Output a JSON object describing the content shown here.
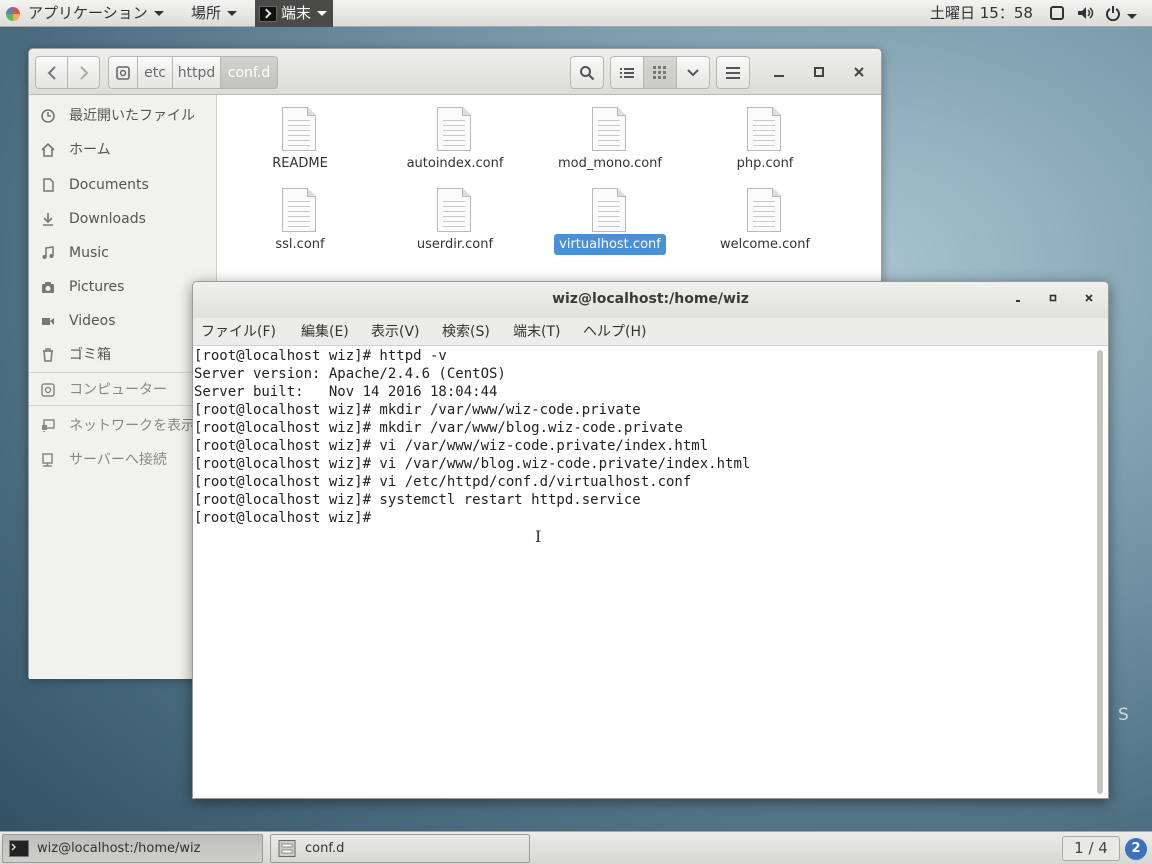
{
  "topbar": {
    "applications": "アプリケーション",
    "places": "場所",
    "terminal_app": "端末",
    "clock": "土曜日 15：58"
  },
  "files": {
    "breadcrumbs": [
      "etc",
      "httpd",
      "conf.d"
    ],
    "sidebar": [
      {
        "label": "最近開いたファイル",
        "icon": "clock-icon"
      },
      {
        "label": "ホーム",
        "icon": "home-icon"
      },
      {
        "label": "Documents",
        "icon": "document-icon"
      },
      {
        "label": "Downloads",
        "icon": "download-icon"
      },
      {
        "label": "Music",
        "icon": "music-icon"
      },
      {
        "label": "Pictures",
        "icon": "camera-icon"
      },
      {
        "label": "Videos",
        "icon": "video-icon"
      },
      {
        "label": "ゴミ箱",
        "icon": "trash-icon"
      },
      {
        "label": "コンピューター",
        "icon": "computer-icon"
      },
      {
        "label": "ネットワークを表示",
        "icon": "network-icon"
      },
      {
        "label": "サーバーへ接続",
        "icon": "server-icon"
      }
    ],
    "items": [
      "README",
      "autoindex.conf",
      "mod_mono.conf",
      "php.conf",
      "ssl.conf",
      "userdir.conf",
      "virtualhost.conf",
      "welcome.conf"
    ],
    "selected": "virtualhost.conf"
  },
  "terminal": {
    "title": "wiz@localhost:/home/wiz",
    "menus": [
      "ファイル(F)",
      "編集(E)",
      "表示(V)",
      "検索(S)",
      "端末(T)",
      "ヘルプ(H)"
    ],
    "lines": [
      "[root@localhost wiz]# httpd -v",
      "Server version: Apache/2.4.6 (CentOS)",
      "Server built:   Nov 14 2016 18:04:44",
      "[root@localhost wiz]# mkdir /var/www/wiz-code.private",
      "[root@localhost wiz]# mkdir /var/www/blog.wiz-code.private",
      "[root@localhost wiz]# vi /var/www/wiz-code.private/index.html",
      "[root@localhost wiz]# vi /var/www/blog.wiz-code.private/index.html",
      "[root@localhost wiz]# vi /etc/httpd/conf.d/virtualhost.conf",
      "[root@localhost wiz]# systemctl restart httpd.service",
      "[root@localhost wiz]#"
    ]
  },
  "taskbar": {
    "tasks": [
      "wiz@localhost:/home/wiz",
      "conf.d"
    ],
    "workspace": "1 / 4",
    "help": "2"
  },
  "desktop_text": "S",
  "colors": {
    "selection": "#4a90d9",
    "topbar_active": "#4a4a48",
    "help_badge": "#3d72b8"
  }
}
